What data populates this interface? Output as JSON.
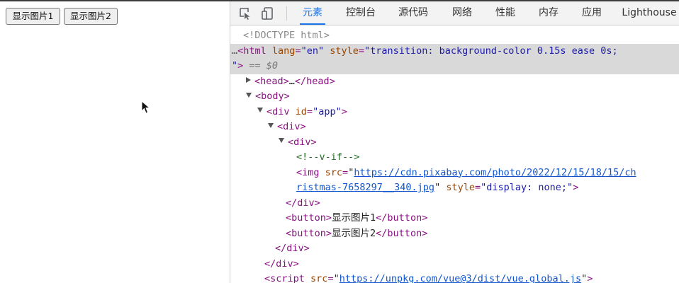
{
  "page": {
    "buttons": [
      "显示图片1",
      "显示图片2"
    ]
  },
  "devtools": {
    "tabs": [
      "元素",
      "控制台",
      "源代码",
      "网络",
      "性能",
      "内存",
      "应用",
      "Lighthouse"
    ],
    "active_tab": "元素",
    "icons": [
      "inspect-element-icon",
      "device-toolbar-icon"
    ],
    "tree": {
      "doctype": "<!DOCTYPE html>",
      "ellipsis": "…",
      "html_open": "<html",
      "lang_attr": "lang",
      "lang_val": "\"en\"",
      "style_attr": "style",
      "html_style_val": "\"transition: background-color 0.15s ease 0s;",
      "html_style_end": "\"",
      "close_bracket": ">",
      "eq_dollar": "== $0",
      "head": "<head>",
      "head_ellipsis": "…",
      "head_close": "</head>",
      "body_open": "<body>",
      "div_open_start": "<div",
      "id_attr": "id",
      "id_val": "\"app\"",
      "div_open": "<div>",
      "comment": "<!--v-if-->",
      "img_open": "<img",
      "src_attr": "src",
      "img_src_part1": "https://cdn.pixabay.com/photo/2022/12/15/18/15/ch",
      "img_src_part2": "ristmas-7658297__340.jpg",
      "img_style_val": "\"display: none;\"",
      "div_close": "</div>",
      "button_open": "<button>",
      "button1_text": "显示图片1",
      "button2_text": "显示图片2",
      "button_close": "</button>",
      "script_open": "<script",
      "script_src": "https://unpkg.com/vue@3/dist/vue.global.js"
    }
  },
  "colors": {
    "active_tab": "#1a73e8",
    "tag": "#881280",
    "attribute": "#994500",
    "value": "#1a1aa6",
    "comment": "#236e25"
  }
}
